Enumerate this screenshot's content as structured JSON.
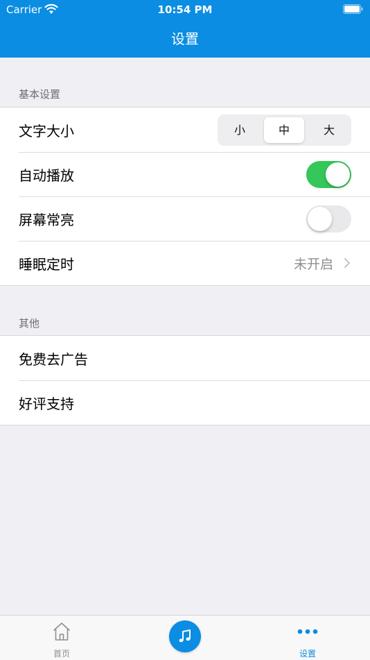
{
  "status_bar": {
    "carrier": "Carrier",
    "time": "10:54 PM"
  },
  "nav": {
    "title": "设置"
  },
  "sections": {
    "basic": {
      "header": "基本设置",
      "rows": {
        "text_size": {
          "label": "文字大小",
          "options": [
            "小",
            "中",
            "大"
          ],
          "selected": "中"
        },
        "autoplay": {
          "label": "自动播放",
          "toggle": "on"
        },
        "screen_on": {
          "label": "屏幕常亮",
          "toggle": "off"
        },
        "sleep_timer": {
          "label": "睡眠定时",
          "value": "未开启"
        }
      }
    },
    "other": {
      "header": "其他",
      "rows": {
        "remove_ads": {
          "label": "免费去广告"
        },
        "rate": {
          "label": "好评支持"
        }
      }
    }
  },
  "tabbar": {
    "home_label": "首页",
    "settings_label": "设置",
    "active": "设置",
    "center_icon": "music-note-icon"
  },
  "colors": {
    "accent": "#0a8de3",
    "toggle_on": "#35c759",
    "secondary_text": "#8e8e93",
    "inactive_tab": "#8e8e93"
  }
}
